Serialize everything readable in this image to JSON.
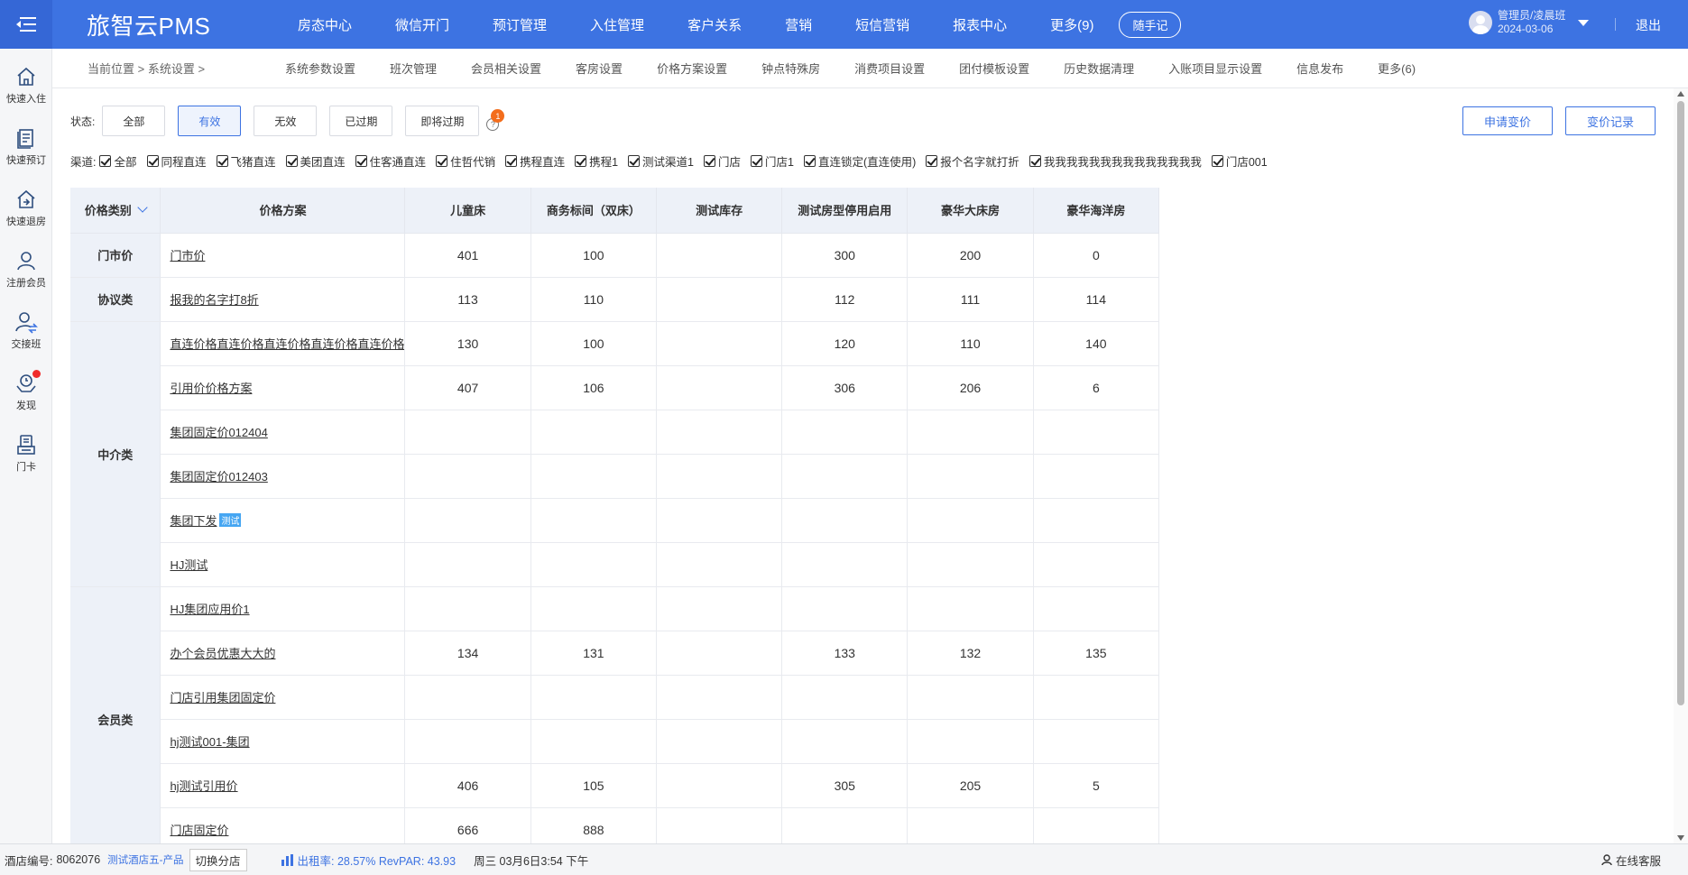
{
  "header": {
    "brand": "旅智云PMS",
    "nav": [
      "房态中心",
      "微信开门",
      "预订管理",
      "入住管理",
      "客户关系",
      "营销",
      "短信营销",
      "报表中心",
      "更多(9)"
    ],
    "notes_button": "随手记",
    "user_name": "管理员/凌晨班",
    "user_date": "2024-03-06",
    "logout": "退出"
  },
  "sidebar": {
    "items": [
      {
        "label": "快速入住",
        "icon": "home-icon"
      },
      {
        "label": "快速预订",
        "icon": "booking-icon"
      },
      {
        "label": "快速退房",
        "icon": "checkout-icon"
      },
      {
        "label": "注册会员",
        "icon": "register-member-icon"
      },
      {
        "label": "交接班",
        "icon": "shift-handover-icon"
      },
      {
        "label": "发现",
        "icon": "discover-icon"
      },
      {
        "label": "门卡",
        "icon": "door-card-icon"
      }
    ]
  },
  "breadcrumb": {
    "current": "当前位置",
    "page": "系统设置"
  },
  "subtabs": [
    "系统参数设置",
    "班次管理",
    "会员相关设置",
    "客房设置",
    "价格方案设置",
    "钟点特殊房",
    "消费项目设置",
    "团付模板设置",
    "历史数据清理",
    "入账项目显示设置",
    "信息发布",
    "更多(6)"
  ],
  "status_filter": {
    "label": "状态:",
    "options": [
      "全部",
      "有效",
      "无效",
      "已过期",
      "即将过期"
    ],
    "selected": "有效",
    "badge": "1",
    "help": "?"
  },
  "actions": {
    "apply_change": "申请变价",
    "change_log": "变价记录"
  },
  "channels": {
    "label": "渠道:",
    "items": [
      "全部",
      "同程直连",
      "飞猪直连",
      "美团直连",
      "住客通直连",
      "住哲代销",
      "携程直连",
      "携程1",
      "测试渠道1",
      "门店",
      "门店1",
      "直连锁定(直连使用)",
      "报个名字就打折",
      "我我我我我我我我我我我我我我",
      "门店001"
    ]
  },
  "table": {
    "columns": [
      "价格类别",
      "价格方案",
      "儿童床",
      "商务标间（双床）",
      "测试库存",
      "测试房型停用启用",
      "豪华大床房",
      "豪华海洋房"
    ],
    "groups": [
      {
        "category": "门市价",
        "rows": [
          {
            "plan": "门市价",
            "tag": "",
            "values": [
              "401",
              "100",
              "",
              "300",
              "200",
              "0"
            ]
          }
        ]
      },
      {
        "category": "协议类",
        "rows": [
          {
            "plan": "报我的名字打8折",
            "tag": "",
            "values": [
              "113",
              "110",
              "",
              "112",
              "111",
              "114"
            ]
          }
        ]
      },
      {
        "category": "中介类",
        "rows": [
          {
            "plan": "直连价格直连价格直连价格直连价格直连价格",
            "tag": "",
            "values": [
              "130",
              "100",
              "",
              "120",
              "110",
              "140"
            ]
          },
          {
            "plan": "引用价价格方案",
            "tag": "",
            "values": [
              "407",
              "106",
              "",
              "306",
              "206",
              "6"
            ]
          },
          {
            "plan": "集团固定价012404",
            "tag": "",
            "values": [
              "",
              "",
              "",
              "",
              "",
              ""
            ]
          },
          {
            "plan": "集团固定价012403",
            "tag": "",
            "values": [
              "",
              "",
              "",
              "",
              "",
              ""
            ]
          },
          {
            "plan": "集团下发",
            "tag": "测试",
            "values": [
              "",
              "",
              "",
              "",
              "",
              ""
            ]
          },
          {
            "plan": "HJ测试",
            "tag": "",
            "values": [
              "",
              "",
              "",
              "",
              "",
              ""
            ]
          }
        ]
      },
      {
        "category": "会员类",
        "rows": [
          {
            "plan": "HJ集团应用价1",
            "tag": "",
            "values": [
              "",
              "",
              "",
              "",
              "",
              ""
            ]
          },
          {
            "plan": "办个会员优惠大大的",
            "tag": "",
            "values": [
              "134",
              "131",
              "",
              "133",
              "132",
              "135"
            ]
          },
          {
            "plan": "门店引用集团固定价",
            "tag": "",
            "values": [
              "",
              "",
              "",
              "",
              "",
              ""
            ]
          },
          {
            "plan": "hj测试001-集团",
            "tag": "",
            "values": [
              "",
              "",
              "",
              "",
              "",
              ""
            ]
          },
          {
            "plan": "hj测试引用价",
            "tag": "",
            "values": [
              "406",
              "105",
              "",
              "305",
              "205",
              "5"
            ]
          },
          {
            "plan": "门店固定价",
            "tag": "",
            "values": [
              "666",
              "888",
              "",
              "",
              "",
              ""
            ]
          }
        ]
      }
    ]
  },
  "statusbar": {
    "hotel_id_label": "酒店编号:",
    "hotel_id": "8062076",
    "hotel_name": "测试酒店五-产品",
    "switch_store": "切换分店",
    "occupancy": "出租率: 28.57% RevPAR: 43.93",
    "datetime": "周三 03月6日3:54 下午",
    "online_service": "在线客服"
  },
  "colors": {
    "primary": "#3d73e2",
    "header_bg": "#3d73e2",
    "table_header_bg": "#edf1f8",
    "badge": "#f36d1c",
    "tag": "#46a6f2"
  }
}
